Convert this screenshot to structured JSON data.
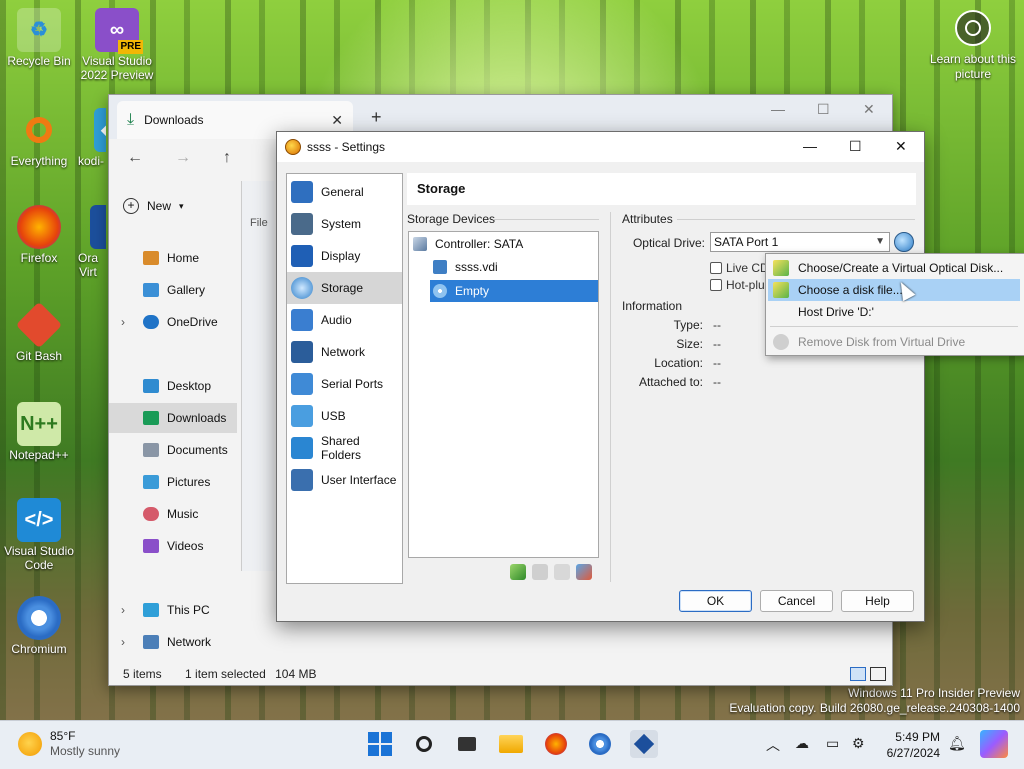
{
  "desktop": {
    "icons": [
      {
        "label": "Recycle Bin",
        "icon": "recycle-bin-icon"
      },
      {
        "label": "Visual Studio 2022 Preview",
        "icon": "visual-studio-icon",
        "badge": "PRE"
      },
      {
        "label": "Everything",
        "icon": "everything-search-icon"
      },
      {
        "label": "kodi-",
        "icon": "kodi-icon"
      },
      {
        "label": "Firefox",
        "icon": "firefox-icon"
      },
      {
        "label": "Ora Virt",
        "icon": "virtualbox-icon"
      },
      {
        "label": "Git Bash",
        "icon": "git-bash-icon"
      },
      {
        "label": "Notepad++",
        "icon": "notepad-plus-plus-icon"
      },
      {
        "label": "Visual Studio Code",
        "icon": "vscode-icon"
      },
      {
        "label": "Chromium",
        "icon": "chromium-icon"
      }
    ],
    "learn_about": "Learn about this picture",
    "watermark": {
      "line1": "Windows 11 Pro Insider Preview",
      "line2": "Evaluation copy. Build 26080.ge_release.240308-1400"
    }
  },
  "explorer": {
    "tab_title": "Downloads",
    "new_label": "New",
    "file_label": "File",
    "sidebar": [
      {
        "label": "Home",
        "icon": "home-icon"
      },
      {
        "label": "Gallery",
        "icon": "gallery-icon"
      },
      {
        "label": "OneDrive",
        "icon": "onedrive-icon",
        "expandable": true
      },
      {
        "label": "Desktop",
        "icon": "desktop-folder-icon"
      },
      {
        "label": "Downloads",
        "icon": "downloads-icon",
        "selected": true
      },
      {
        "label": "Documents",
        "icon": "documents-icon"
      },
      {
        "label": "Pictures",
        "icon": "pictures-icon"
      },
      {
        "label": "Music",
        "icon": "music-icon"
      },
      {
        "label": "Videos",
        "icon": "videos-icon"
      },
      {
        "label": "This PC",
        "icon": "this-pc-icon",
        "expandable": true
      },
      {
        "label": "Network",
        "icon": "network-icon",
        "expandable": true
      }
    ],
    "status": {
      "items": "5 items",
      "selected": "1 item selected",
      "size": "104 MB"
    }
  },
  "dialog": {
    "title": "ssss - Settings",
    "nav": [
      {
        "label": "General",
        "icon": "general-icon"
      },
      {
        "label": "System",
        "icon": "system-icon"
      },
      {
        "label": "Display",
        "icon": "display-icon"
      },
      {
        "label": "Storage",
        "icon": "storage-icon",
        "selected": true
      },
      {
        "label": "Audio",
        "icon": "audio-icon"
      },
      {
        "label": "Network",
        "icon": "network-adapter-icon"
      },
      {
        "label": "Serial Ports",
        "icon": "serial-ports-icon"
      },
      {
        "label": "USB",
        "icon": "usb-icon"
      },
      {
        "label": "Shared Folders",
        "icon": "shared-folders-icon"
      },
      {
        "label": "User Interface",
        "icon": "user-interface-icon"
      }
    ],
    "page_title": "Storage",
    "storage_devices_label": "Storage Devices",
    "tree": {
      "controller": "Controller: SATA",
      "items": [
        {
          "label": "ssss.vdi",
          "icon": "hard-disk-icon"
        },
        {
          "label": "Empty",
          "icon": "optical-disk-icon",
          "selected": true
        }
      ]
    },
    "attributes": {
      "label": "Attributes",
      "optical_drive_label": "Optical Drive:",
      "optical_drive_value": "SATA Port 1",
      "live_cd": "Live CD",
      "hot_plug": "Hot-plug"
    },
    "information": {
      "label": "Information",
      "rows": [
        {
          "key": "Type:",
          "value": "--"
        },
        {
          "key": "Size:",
          "value": "--"
        },
        {
          "key": "Location:",
          "value": "--"
        },
        {
          "key": "Attached to:",
          "value": "--"
        }
      ]
    },
    "buttons": {
      "ok": "OK",
      "cancel": "Cancel",
      "help": "Help"
    }
  },
  "context_menu": {
    "items": [
      {
        "label": "Choose/Create a Virtual Optical Disk...",
        "icon": "add-disk-icon"
      },
      {
        "label": "Choose a disk file...",
        "icon": "choose-disk-icon",
        "highlighted": true
      },
      {
        "label": "Host Drive 'D:'",
        "icon": ""
      },
      {
        "label": "Remove Disk from Virtual Drive",
        "icon": "remove-disk-icon",
        "disabled": true
      }
    ]
  },
  "taskbar": {
    "weather": {
      "temp": "85°F",
      "condition": "Mostly sunny"
    },
    "clock": {
      "time": "5:49 PM",
      "date": "6/27/2024"
    },
    "apps": [
      "start-icon",
      "search-icon",
      "task-view-icon",
      "file-explorer-icon",
      "firefox-icon",
      "chromium-icon",
      "virtualbox-icon"
    ]
  },
  "colors": {
    "selection_blue": "#2d7ed6",
    "menu_highlight": "#a9d1f5",
    "default_button_border": "#2b6cc4"
  }
}
